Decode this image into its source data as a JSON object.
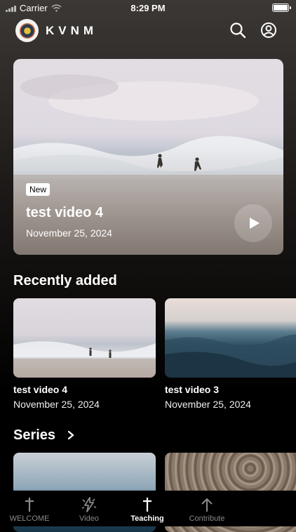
{
  "status_bar": {
    "carrier": "Carrier",
    "time": "8:29 PM"
  },
  "header": {
    "brand": "KVNM",
    "icons": [
      "search-icon",
      "profile-icon"
    ]
  },
  "featured": {
    "badge": "New",
    "title": "test video 4",
    "date": "November 25, 2024"
  },
  "recently_added": {
    "title": "Recently added",
    "items": [
      {
        "title": "test video 4",
        "date": "November 25, 2024"
      },
      {
        "title": "test video 3",
        "date": "November 25, 2024"
      }
    ]
  },
  "series": {
    "title": "Series"
  },
  "tab_bar": {
    "tabs": [
      {
        "label": "WELCOME",
        "icon": "cross-icon",
        "active": false
      },
      {
        "label": "Video",
        "icon": "video-lightning-icon",
        "active": false
      },
      {
        "label": "Teaching",
        "icon": "cross-icon",
        "active": true
      },
      {
        "label": "Contribute",
        "icon": "arrow-up-icon",
        "active": false
      }
    ]
  },
  "colors": {
    "background": "#000000",
    "text": "#ffffff",
    "inactive_tab": "#8a8a8a"
  }
}
